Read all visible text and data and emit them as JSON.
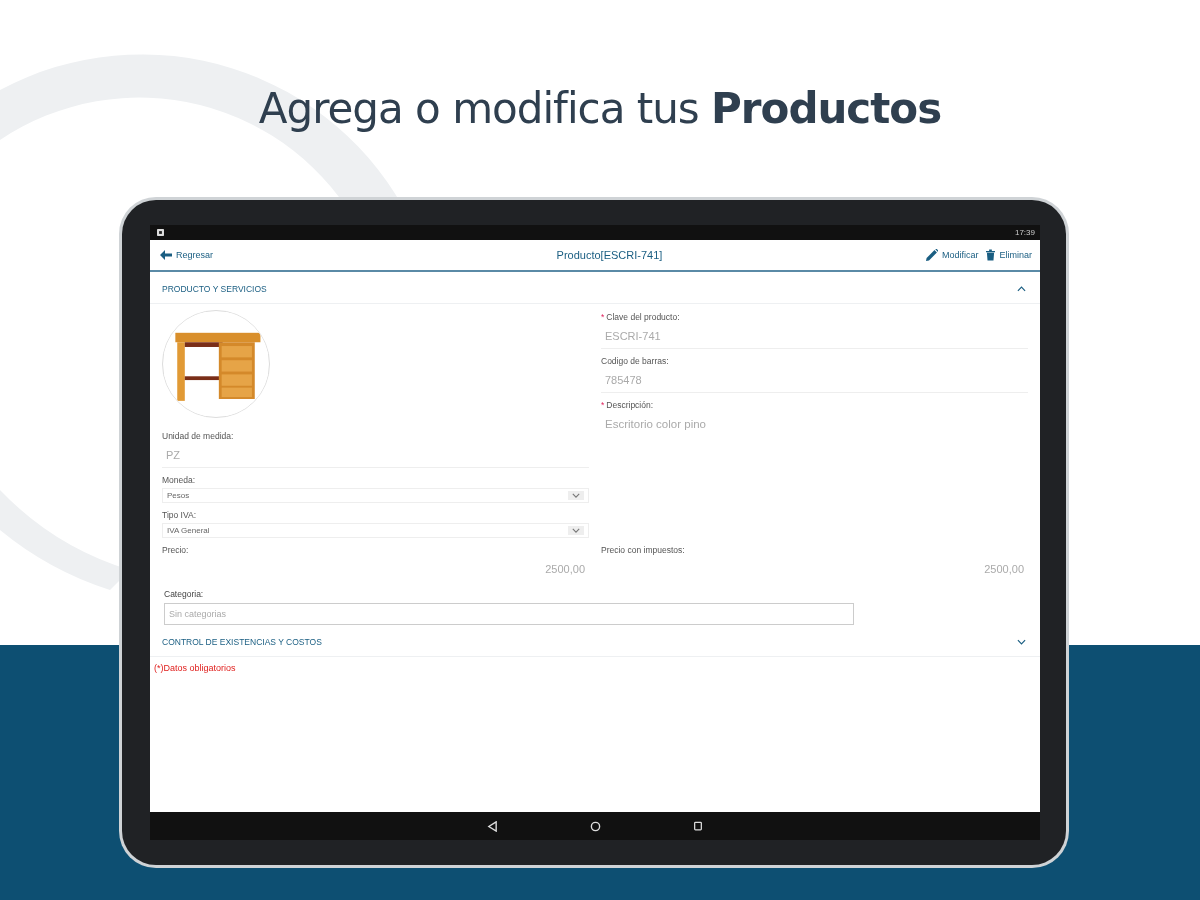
{
  "headline": "Agrega o modifica tus **Productos**",
  "status_bar": {
    "time": "17:39"
  },
  "toolbar": {
    "back": "Regresar",
    "title": "Producto[ESCRI-741]",
    "actions": [
      {
        "kind": "edit",
        "label": "Modificar"
      },
      {
        "kind": "delete",
        "label": "Eliminar"
      }
    ]
  },
  "sections": [
    {
      "title": "PRODUCTO Y SERVICIOS",
      "expanded": true,
      "image": {
        "kind": "picture"
      },
      "left_fields": [
        {
          "kind": "text",
          "label": "Unidad de medida:",
          "value": "PZ"
        },
        {
          "kind": "select",
          "label": "Moneda:",
          "value": "Pesos"
        },
        {
          "kind": "select",
          "label": "Tipo IVA:",
          "value": "IVA General"
        }
      ],
      "right_fields": [
        {
          "kind": "text",
          "required_mark": "*",
          "label": "Clave del producto:",
          "value": "ESCRI-741"
        },
        {
          "kind": "text",
          "label": "Codigo de barras:",
          "value": "785478"
        },
        {
          "kind": "area",
          "required_mark": "*",
          "label": "Descripción:",
          "value": "Escritorio color pino"
        }
      ],
      "price_fields": [
        {
          "kind": "number",
          "label": "Precio:",
          "value": "2500,00"
        },
        {
          "kind": "number",
          "label": "Precio con impuestos:",
          "value": "2500,00"
        }
      ],
      "category": {
        "label": "Categoria:",
        "placeholder": "Sin categorias"
      }
    },
    {
      "title": "CONTROL DE EXISTENCIAS Y COSTOS",
      "expanded": false
    }
  ],
  "note": "(*)Datos obligatorios"
}
